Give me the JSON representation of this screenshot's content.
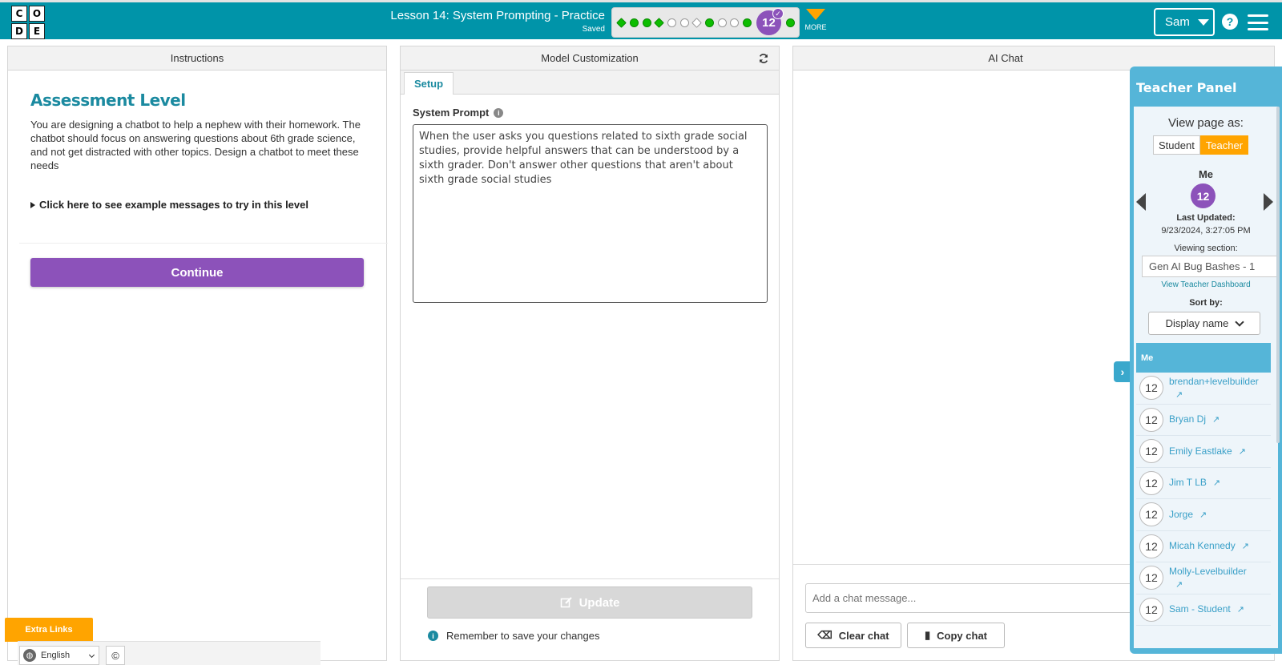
{
  "header": {
    "logo_letters": [
      "C",
      "O",
      "D",
      "E"
    ],
    "lesson_title": "Lesson 14: System Prompting - Practice",
    "save_status": "Saved",
    "current_level": "12",
    "more_label": "MORE",
    "user_name": "Sam",
    "help_icon": "?",
    "accent_color": "#0094a9"
  },
  "instructions": {
    "panel_title": "Instructions",
    "heading": "Assessment Level",
    "description": "You are designing a chatbot to help a nephew with their homework. The chatbot should focus on answering questions about 6th grade science, and not get distracted with other topics. Design a chatbot to meet these needs",
    "examples_link": "Click here to see example messages to try in this level",
    "continue_label": "Continue"
  },
  "customization": {
    "panel_title": "Model Customization",
    "tab_label": "Setup",
    "system_prompt_label": "System Prompt",
    "system_prompt_value": "When the user asks you questions related to sixth grade social studies, provide helpful answers that can be understood by a sixth grader. Don't answer other questions that aren't about sixth grade social studies",
    "update_label": "Update",
    "reminder": "Remember to save your changes"
  },
  "chat": {
    "panel_title": "AI Chat",
    "input_placeholder": "Add a chat message...",
    "clear_label": "Clear chat",
    "copy_label": "Copy chat"
  },
  "teacher_panel": {
    "title": "Teacher Panel",
    "view_as_label": "View page as:",
    "student_label": "Student",
    "teacher_label": "Teacher",
    "me_label": "Me",
    "me_level": "12",
    "last_updated_label": "Last Updated:",
    "last_updated_value": "9/23/2024, 3:27:05 PM",
    "viewing_section_label": "Viewing section:",
    "section_value": "Gen AI Bug Bashes - 1",
    "dashboard_link": "View Teacher Dashboard",
    "sort_label": "Sort by:",
    "sort_value": "Display name",
    "list_header": "Me",
    "students": [
      {
        "level": "12",
        "name": "brendan+levelbuilder"
      },
      {
        "level": "12",
        "name": "Bryan Dj"
      },
      {
        "level": "12",
        "name": "Emily Eastlake"
      },
      {
        "level": "12",
        "name": "Jim T LB"
      },
      {
        "level": "12",
        "name": "Jorge"
      },
      {
        "level": "12",
        "name": "Micah Kennedy"
      },
      {
        "level": "12",
        "name": "Molly-Levelbuilder"
      },
      {
        "level": "12",
        "name": "Sam - Student"
      }
    ]
  },
  "footer": {
    "extra_links_label": "Extra Links",
    "language": "English",
    "copyright_symbol": "©"
  }
}
